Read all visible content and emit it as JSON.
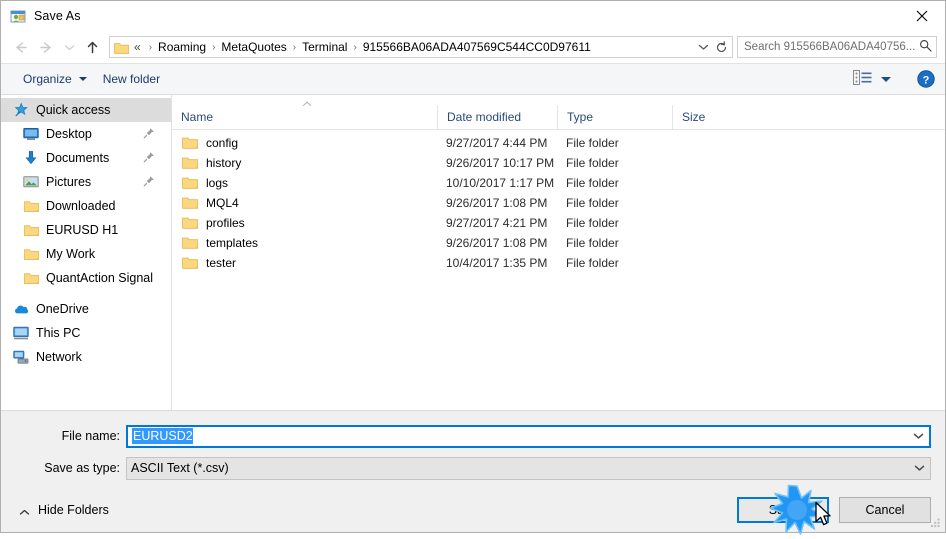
{
  "window": {
    "title": "Save As",
    "title_icon": "save-as-icon",
    "close_icon": "close-icon"
  },
  "nav": {
    "back_icon": "back-arrow-icon",
    "forward_icon": "forward-arrow-icon",
    "recent_icon": "recent-locations-chevron-icon",
    "up_icon": "up-arrow-icon",
    "address": {
      "folder_icon": "folder-icon",
      "lead": "«",
      "crumbs": [
        "Roaming",
        "MetaQuotes",
        "Terminal",
        "915566BA06ADA407569C544CC0D97611"
      ],
      "separator": "›",
      "dropdown_icon": "chevron-down-icon",
      "refresh_icon": "refresh-icon"
    },
    "search": {
      "placeholder": "Search 915566BA06ADA40756...",
      "icon": "search-icon"
    }
  },
  "toolbar": {
    "organize_label": "Organize",
    "new_folder_label": "New folder",
    "view_icon": "list-view-icon",
    "view_dropdown_icon": "chevron-down-icon",
    "help_icon": "help-icon"
  },
  "sidebar": {
    "items": [
      {
        "label": "Quick access",
        "icon": "star-pin-icon",
        "selected": true,
        "root": true,
        "pinned": false
      },
      {
        "label": "Desktop",
        "icon": "desktop-icon",
        "selected": false,
        "root": false,
        "pinned": true
      },
      {
        "label": "Documents",
        "icon": "documents-icon",
        "selected": false,
        "root": false,
        "pinned": true
      },
      {
        "label": "Pictures",
        "icon": "pictures-icon",
        "selected": false,
        "root": false,
        "pinned": true
      },
      {
        "label": "Downloaded",
        "icon": "folder-icon",
        "selected": false,
        "root": false,
        "pinned": false
      },
      {
        "label": "EURUSD H1",
        "icon": "folder-icon",
        "selected": false,
        "root": false,
        "pinned": false
      },
      {
        "label": "My Work",
        "icon": "folder-icon",
        "selected": false,
        "root": false,
        "pinned": false
      },
      {
        "label": "QuantAction Signal",
        "icon": "folder-icon",
        "selected": false,
        "root": false,
        "pinned": false
      },
      {
        "label": "OneDrive",
        "icon": "onedrive-icon",
        "selected": false,
        "root": true,
        "pinned": false
      },
      {
        "label": "This PC",
        "icon": "this-pc-icon",
        "selected": false,
        "root": true,
        "pinned": false
      },
      {
        "label": "Network",
        "icon": "network-icon",
        "selected": false,
        "root": true,
        "pinned": false
      }
    ]
  },
  "filelist": {
    "columns": [
      "Name",
      "Date modified",
      "Type",
      "Size"
    ],
    "sort_indicator": "ascending",
    "rows": [
      {
        "name": "config",
        "date": "9/27/2017 4:44 PM",
        "type": "File folder",
        "size": ""
      },
      {
        "name": "history",
        "date": "9/26/2017 10:17 PM",
        "type": "File folder",
        "size": ""
      },
      {
        "name": "logs",
        "date": "10/10/2017 1:17 PM",
        "type": "File folder",
        "size": ""
      },
      {
        "name": "MQL4",
        "date": "9/26/2017 1:08 PM",
        "type": "File folder",
        "size": ""
      },
      {
        "name": "profiles",
        "date": "9/27/2017 4:21 PM",
        "type": "File folder",
        "size": ""
      },
      {
        "name": "templates",
        "date": "9/26/2017 1:08 PM",
        "type": "File folder",
        "size": ""
      },
      {
        "name": "tester",
        "date": "10/4/2017 1:35 PM",
        "type": "File folder",
        "size": ""
      }
    ]
  },
  "form": {
    "filename_label": "File name:",
    "filename_value": "EURUSD2",
    "filetype_label": "Save as type:",
    "filetype_value": "ASCII Text (*.csv)",
    "dropdown_icon": "chevron-down-icon"
  },
  "footer": {
    "hide_folders_label": "Hide Folders",
    "hide_folders_icon": "chevron-up-icon",
    "save_label": "Save",
    "cancel_label": "Cancel",
    "resize_grip_icon": "resize-grip-icon"
  },
  "overlay": {
    "click_burst_icon": "click-burst-icon",
    "cursor_icon": "mouse-cursor-icon"
  },
  "colors": {
    "accent": "#0078d7",
    "selection": "#3399ff",
    "header_text": "#2a4a7c",
    "command_text": "#1b3b6f"
  }
}
